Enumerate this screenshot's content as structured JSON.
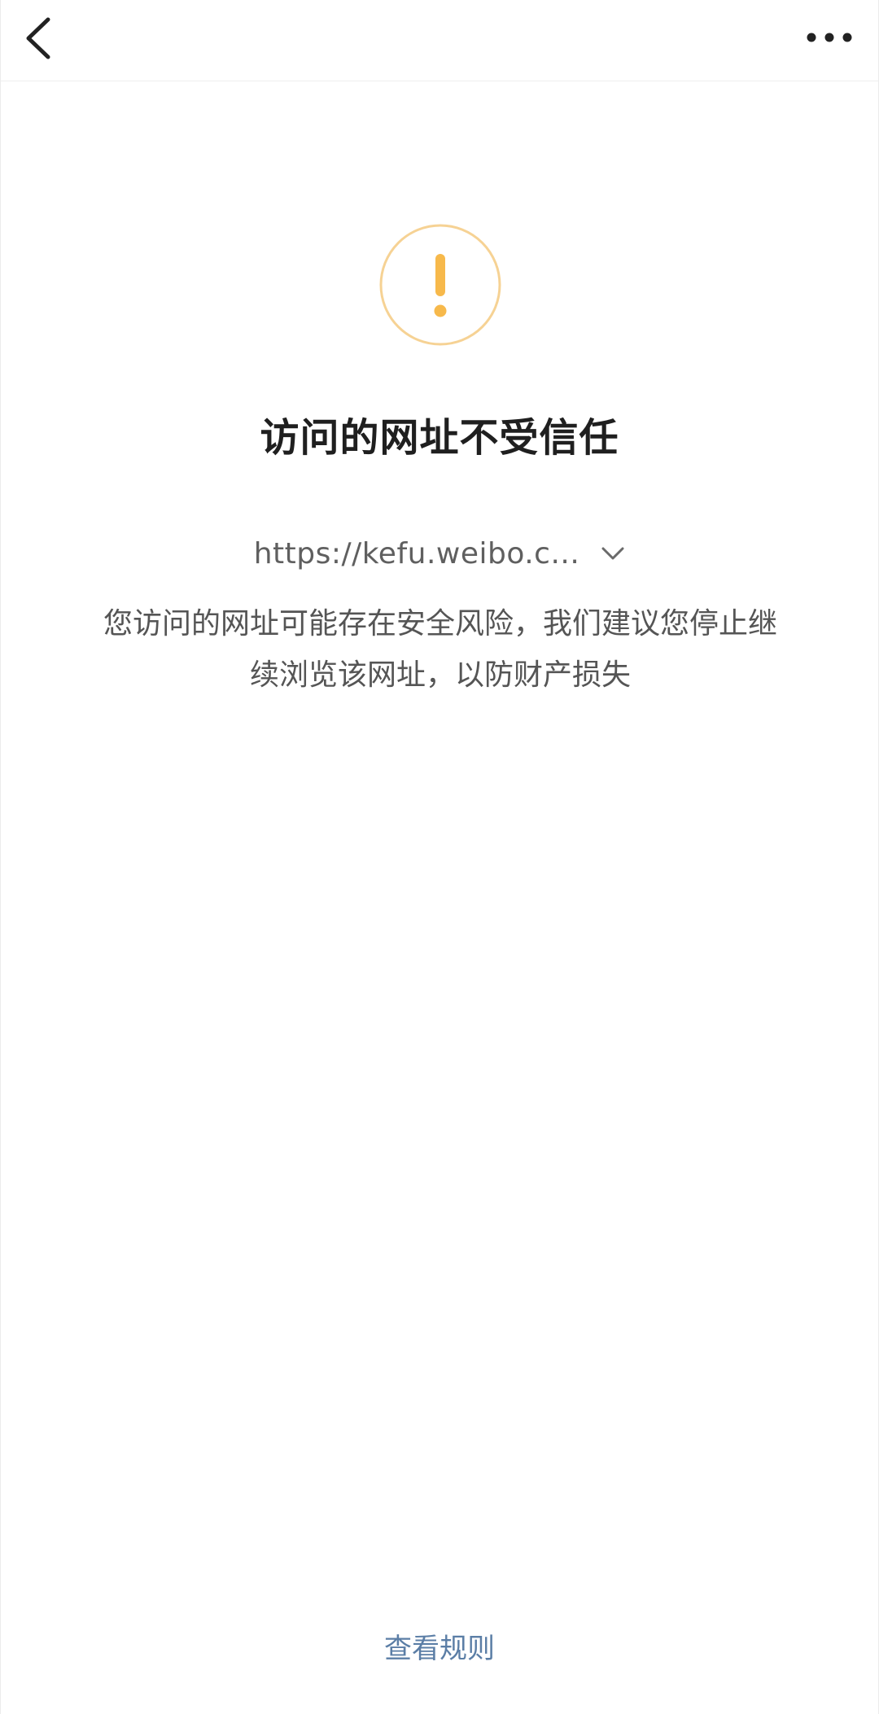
{
  "header": {
    "back_icon": "chevron-left-icon",
    "more_icon": "more-dots-icon"
  },
  "warning": {
    "icon": "exclamation-icon",
    "ring_color": "#f6d294",
    "mark_color": "#f7b94b"
  },
  "main": {
    "title": "访问的网址不受信任",
    "url": "https://kefu.weibo.c...",
    "url_expand_icon": "chevron-down-icon",
    "description": "您访问的网址可能存在安全风险，我们建议您停止继续浏览该网址，以防财产损失"
  },
  "footer": {
    "rules_link": "查看规则",
    "link_color": "#5b7ea6"
  }
}
